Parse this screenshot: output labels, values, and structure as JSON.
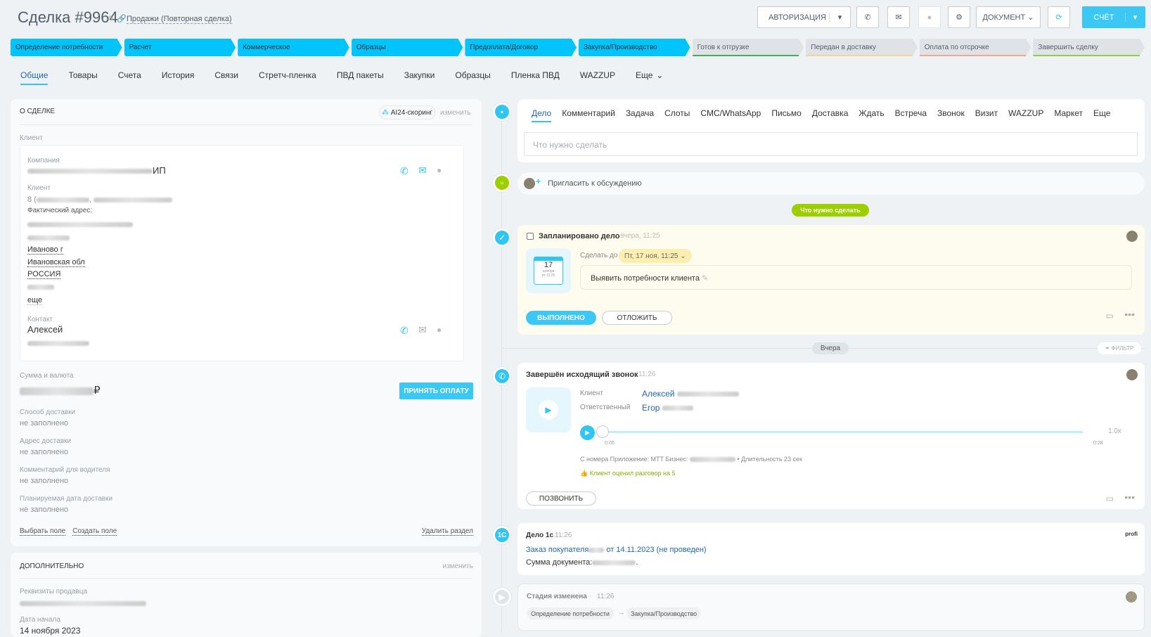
{
  "header": {
    "title": "Сделка #9964",
    "pipeline": "Продажи (Повторная сделка)",
    "auth_button": "АВТОРИЗАЦИЯ",
    "document_button": "ДОКУМЕНТ",
    "invoice_button": "СЧЁТ"
  },
  "stages": [
    {
      "label": "Определение потребности",
      "state": "done"
    },
    {
      "label": "Расчет",
      "state": "done"
    },
    {
      "label": "Коммерческое",
      "state": "done"
    },
    {
      "label": "Образцы",
      "state": "done"
    },
    {
      "label": "Предоплата/Договор",
      "state": "done"
    },
    {
      "label": "Закупка/Производство",
      "state": "done"
    },
    {
      "label": "Готов к отгрузке",
      "state": "todo",
      "color": "#3bb35a"
    },
    {
      "label": "Передан в доставку",
      "state": "todo",
      "color": "#f5d78a"
    },
    {
      "label": "Оплата по отсрочке",
      "state": "todo",
      "color": "#f4a48f"
    },
    {
      "label": "Завершить сделку",
      "state": "todo",
      "color": "#8fd13c"
    }
  ],
  "tabs": [
    "Общие",
    "Товары",
    "Счета",
    "История",
    "Связи",
    "Стретч-пленка",
    "ПВД пакеты",
    "Закупки",
    "Образцы",
    "Пленка ПВД",
    "WAZZUP",
    "Еще"
  ],
  "about": {
    "title": "О СДЕЛКЕ",
    "scoring": "AI24-скоринг",
    "edit": "изменить",
    "client_label": "Клиент",
    "company_label": "Компания",
    "company_suffix": "ИП",
    "client_sub_label": "Клиент",
    "phone_prefix": "8 (",
    "address_label": "Фактический адрес:",
    "city": "Иваново г",
    "region": "Ивановская обл",
    "country": "РОССИЯ",
    "more": "еще",
    "contact_label": "Контакт",
    "contact_name": "Алексей",
    "sum_label": "Сумма и валюта",
    "currency": "₽",
    "accept_payment": "ПРИНЯТЬ ОПЛАТУ",
    "fields": [
      {
        "label": "Способ доставки",
        "value": "не заполнено"
      },
      {
        "label": "Адрес доставки",
        "value": "не заполнено"
      },
      {
        "label": "Комментарий для водителя",
        "value": "не заполнено"
      },
      {
        "label": "Планируемая дата доставки",
        "value": "не заполнено"
      }
    ],
    "select_field": "Выбрать поле",
    "create_field": "Создать поле",
    "delete_section": "Удалить раздел"
  },
  "extra": {
    "title": "ДОПОЛНИТЕЛЬНО",
    "edit": "изменить",
    "seller_label": "Реквизиты продавца",
    "start_label": "Дата начала",
    "start_value": "14 ноября 2023"
  },
  "timeline": {
    "tabs": [
      "Дело",
      "Комментарий",
      "Задача",
      "Слоты",
      "СМС/WhatsApp",
      "Письмо",
      "Доставка",
      "Ждать",
      "Встреча",
      "Звонок",
      "Визит",
      "WAZZUP",
      "Маркет",
      "Еще"
    ],
    "todo_placeholder": "Что нужно сделать",
    "invite": "Пригласить к обсуждению",
    "todo_badge": "Что нужно сделать",
    "planned": {
      "title": "Запланировано дело",
      "time": "вчера, 11:25",
      "deadline_label": "Сделать до",
      "deadline": "Пт, 17 ноя, 11:25",
      "cal_day": "17",
      "cal_month": "ноября",
      "cal_time": "пт 11:25",
      "text": "Выявить потребности клиента",
      "done": "ВЫПОЛНЕНО",
      "postpone": "ОТЛОЖИТЬ"
    },
    "day_sep": "Вчера",
    "filter": "ФИЛЬТР",
    "call": {
      "title": "Завершён исходящий звонок",
      "time": "11:26",
      "client_label": "Клиент",
      "client": "Алексей",
      "resp_label": "Ответственный",
      "resp": "Егор",
      "start": "0:00",
      "end": "0:28",
      "speed": "1.0x",
      "from": "С номера Приложение: МТТ Бизнес:",
      "duration": "• Длительность 23 сек",
      "rating": "Клиент оценил разговор на 5",
      "call_btn": "ПОЗВОНИТЬ"
    },
    "onec": {
      "title": "Дело 1с",
      "time": "11:26",
      "order": "Заказ покупателя",
      "order_rest": "от 14.11.2023 (не проведен)",
      "sum": "Сумма документа:",
      "logo": "profi"
    },
    "stage_change": {
      "title": "Стадия изменена",
      "time": "11:26",
      "from": "Определение потребности",
      "to": "Закупка/Производство"
    }
  }
}
